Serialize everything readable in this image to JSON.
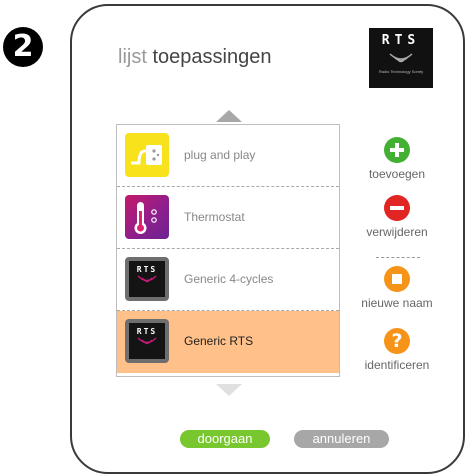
{
  "step_number": "2",
  "title": {
    "light": "lijst",
    "strong": "toepassingen"
  },
  "logo": {
    "text": "RTS",
    "tagline": "Radio Technology Somfy"
  },
  "items": [
    {
      "label": "plug and play",
      "icon": "plug-and-play-icon",
      "selected": false
    },
    {
      "label": "Thermostat",
      "icon": "thermostat-icon",
      "selected": false
    },
    {
      "label": "Generic 4-cycles",
      "icon": "rts-icon",
      "selected": false
    },
    {
      "label": "Generic RTS",
      "icon": "rts-icon",
      "selected": true
    }
  ],
  "item_icon_text": "RTS",
  "actions": {
    "add": "toevoegen",
    "remove": "verwijderen",
    "rename": "nieuwe naam",
    "identify": "identificeren",
    "identify_glyph": "?"
  },
  "buttons": {
    "continue": "doorgaan",
    "cancel": "annuleren"
  },
  "colors": {
    "selected_row": "#ffc08a",
    "add": "#43b034",
    "remove": "#e02522",
    "rename": "#f59419",
    "identify": "#f59419",
    "continue_button": "#78c72e",
    "cancel_button": "#a7a7a7"
  }
}
